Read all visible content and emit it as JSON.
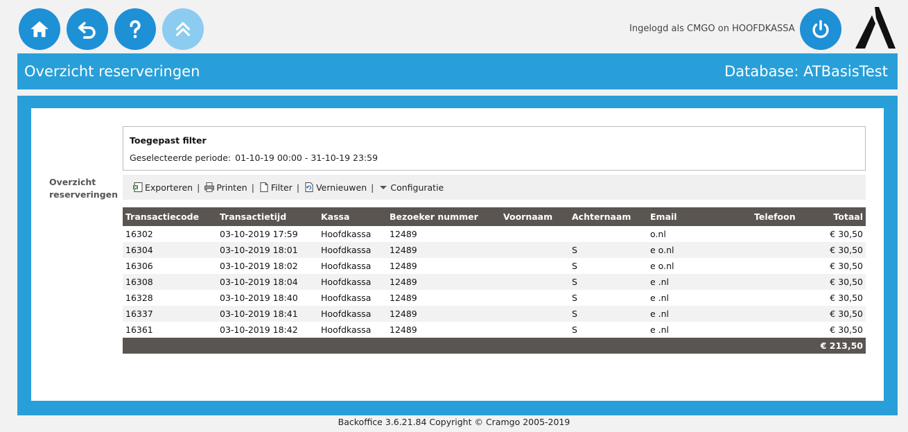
{
  "toolbar_buttons": [
    {
      "name": "home-button",
      "icon": "home-icon"
    },
    {
      "name": "back-button",
      "icon": "undo-arrow-icon"
    },
    {
      "name": "help-button",
      "icon": "question-icon"
    },
    {
      "name": "scroll-up-button",
      "icon": "double-chevron-up-icon"
    }
  ],
  "login_text": "Ingelogd als CMGO on HOOFDKASSA",
  "logo_icon": "cramgo-logo",
  "colors": {
    "accent": "#289fd9",
    "button": "#1e90d6",
    "button_light": "#8cccf0",
    "grid_header": "#5a5550"
  },
  "header": {
    "title": "Overzicht reserveringen",
    "database": "Database: ATBasisTest"
  },
  "side_label": "Overzicht reserveringen",
  "filter": {
    "title": "Toegepast filter",
    "period_label": "Geselecteerde periode:",
    "period_value": "01-10-19 00:00 - 31-10-19 23:59"
  },
  "actions": {
    "export": "Exporteren",
    "print": "Printen",
    "filter": "Filter",
    "refresh": "Vernieuwen",
    "config": "Configuratie"
  },
  "table": {
    "columns": [
      "Transactiecode",
      "Transactietijd",
      "Kassa",
      "Bezoeker nummer",
      "Voornaam",
      "Achternaam",
      "Email",
      "Telefoon",
      "Totaal"
    ],
    "rows": [
      {
        "code": "16302",
        "time": "03-10-2019 17:59",
        "kassa": "Hoofdkassa",
        "visitor": "12489",
        "first": "",
        "last": "",
        "email": "o.nl",
        "phone": "",
        "total": "€ 30,50"
      },
      {
        "code": "16304",
        "time": "03-10-2019 18:01",
        "kassa": "Hoofdkassa",
        "visitor": "12489",
        "first": "",
        "last": "S",
        "email": "e o.nl",
        "phone": "",
        "total": "€ 30,50"
      },
      {
        "code": "16306",
        "time": "03-10-2019 18:02",
        "kassa": "Hoofdkassa",
        "visitor": "12489",
        "first": "",
        "last": "S",
        "email": "e o.nl",
        "phone": "",
        "total": "€ 30,50"
      },
      {
        "code": "16308",
        "time": "03-10-2019 18:04",
        "kassa": "Hoofdkassa",
        "visitor": "12489",
        "first": "",
        "last": "S",
        "email": "e .nl",
        "phone": "",
        "total": "€ 30,50"
      },
      {
        "code": "16328",
        "time": "03-10-2019 18:40",
        "kassa": "Hoofdkassa",
        "visitor": "12489",
        "first": "",
        "last": "S",
        "email": "e .nl",
        "phone": "",
        "total": "€ 30,50"
      },
      {
        "code": "16337",
        "time": "03-10-2019 18:41",
        "kassa": "Hoofdkassa",
        "visitor": "12489",
        "first": "",
        "last": "S",
        "email": "e .nl",
        "phone": "",
        "total": "€ 30,50"
      },
      {
        "code": "16361",
        "time": "03-10-2019 18:42",
        "kassa": "Hoofdkassa",
        "visitor": "12489",
        "first": "",
        "last": "S",
        "email": "e .nl",
        "phone": "",
        "total": "€ 30,50"
      }
    ],
    "grand_total": "€ 213,50"
  },
  "footer": "Backoffice 3.6.21.84 Copyright © Cramgo 2005-2019"
}
